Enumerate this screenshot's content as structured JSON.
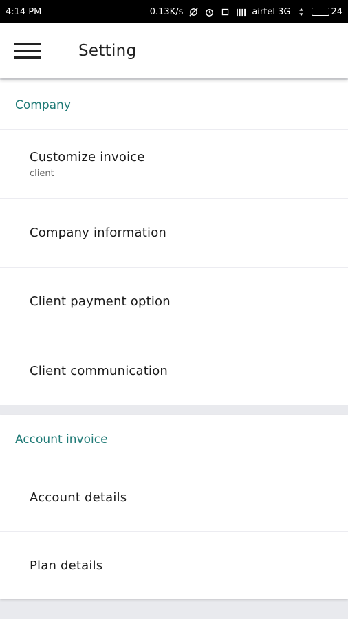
{
  "status_bar": {
    "time": "4:14 PM",
    "network_speed": "0.13K/s",
    "carrier": "airtel 3G",
    "battery_level": "24",
    "icons": [
      "sync-off-icon",
      "alarm-icon",
      "screen-icon",
      "signal-icon",
      "data-arrows-icon",
      "battery-icon"
    ]
  },
  "app_bar": {
    "menu_icon": "hamburger-menu-icon",
    "title": "Setting"
  },
  "sections": {
    "company": {
      "header": "Company",
      "items": [
        {
          "title": "Customize invoice",
          "subtitle": "client"
        },
        {
          "title": "Company information"
        },
        {
          "title": "Client payment option"
        },
        {
          "title": "Client communication"
        }
      ]
    },
    "account": {
      "header": "Account invoice",
      "items": [
        {
          "title": "Account details"
        },
        {
          "title": "Plan details"
        }
      ]
    }
  },
  "colors": {
    "accent": "#1f7a76",
    "background": "#e9eaee",
    "status_bar": "#000000"
  }
}
